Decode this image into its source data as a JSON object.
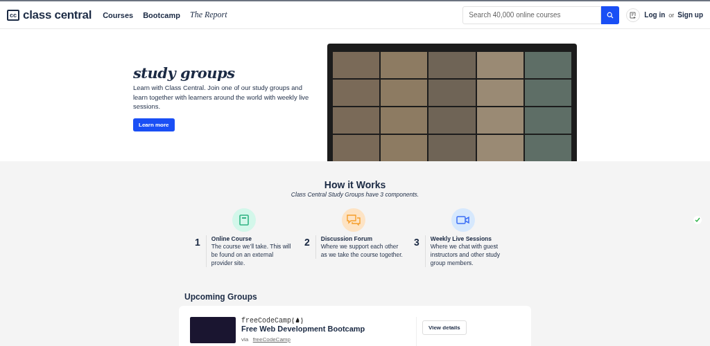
{
  "header": {
    "logo_mark": "cc",
    "logo": "class central",
    "nav": [
      {
        "label": "Courses",
        "kind": "plain"
      },
      {
        "label": "Bootcamp",
        "kind": "plain"
      },
      {
        "label": "The Report",
        "kind": "serif"
      }
    ],
    "search": {
      "placeholder": "Search 40,000 online courses"
    },
    "login": "Log in",
    "or": "or",
    "signup": "Sign up"
  },
  "hero": {
    "title": "study groups",
    "text": "Learn with Class Central. Join one of our study groups and learn together with learners around the world with weekly live sessions.",
    "button": "Learn more"
  },
  "how": {
    "title": "How it Works",
    "subtitle": "Class Central Study Groups have 3 components.",
    "steps": [
      {
        "number": "1",
        "kind": "book",
        "color": "#d3f7ea",
        "title": "Online Course",
        "text": "The course we’ll take. This will be found on an external provider site."
      },
      {
        "number": "2",
        "kind": "chat",
        "color": "#fde3c4",
        "title": "Discussion Forum",
        "text": "Where we support each other as we take the course together."
      },
      {
        "number": "3",
        "kind": "video",
        "color": "#d6e8fd",
        "title": "Weekly Live Sessions",
        "text": "Where we chat with guest instructors and other study group members."
      }
    ]
  },
  "upcoming": {
    "title": "Upcoming Groups",
    "groups": [
      {
        "provider_logo": "freeCodeCamp",
        "title": "Free Web Development Bootcamp",
        "via": "via",
        "provider": "freeCodeCamp",
        "button": "View details"
      }
    ]
  }
}
